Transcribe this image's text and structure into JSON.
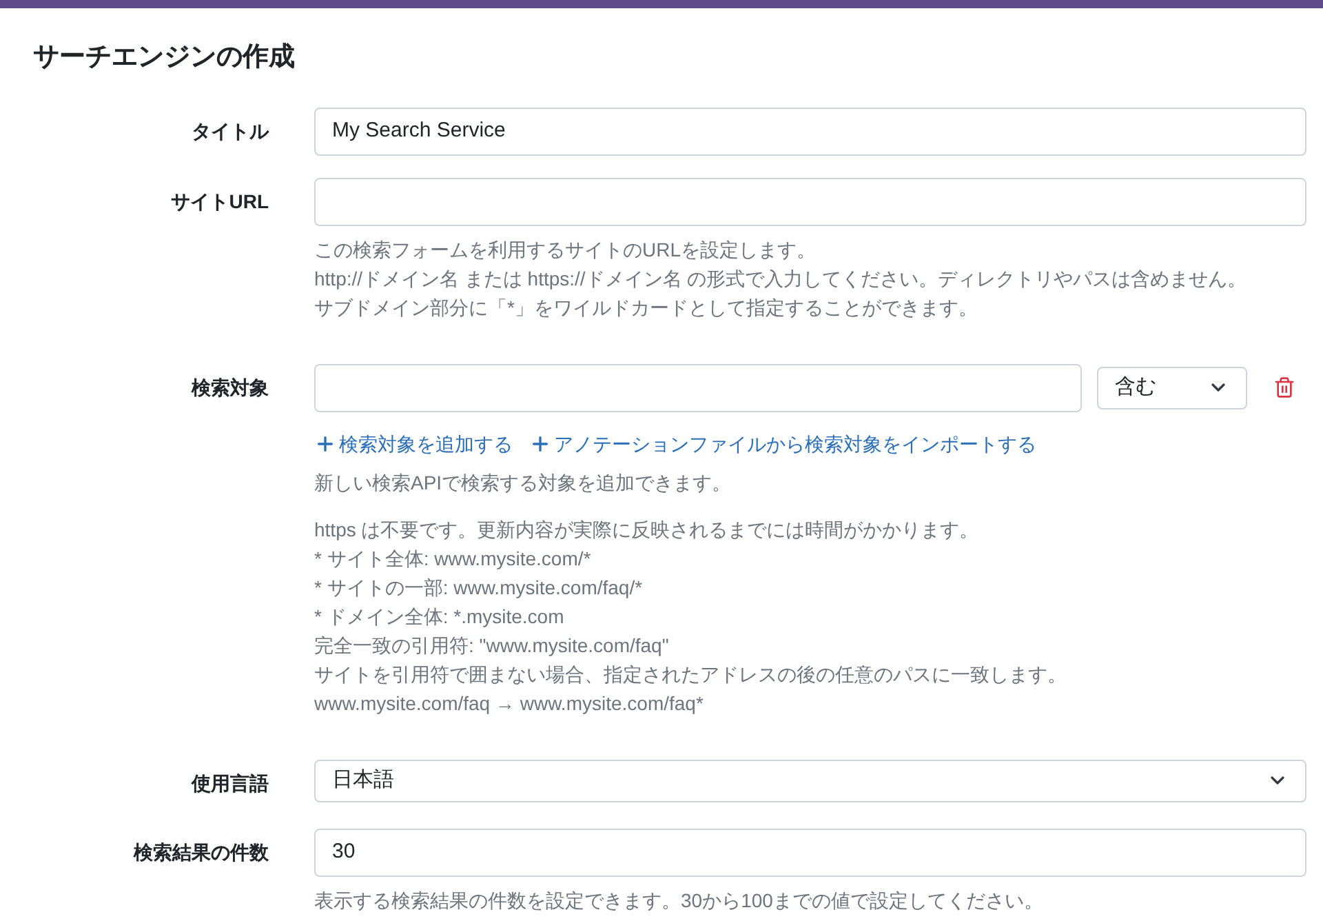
{
  "heading": "サーチエンジンの作成",
  "fields": [
    {
      "kind": "text",
      "label": "タイトル",
      "value": "My Search Service"
    },
    {
      "kind": "text",
      "label": "サイトURL",
      "help": [
        "この検索フォームを利用するサイトのURLを設定します。",
        "http://ドメイン名 または https://ドメイン名 の形式で入力してください。ディレクトリやパスは含めません。",
        "サブドメイン部分に「*」をワイルドカードとして指定することができます。"
      ]
    },
    {
      "kind": "target",
      "label": "検索対象",
      "match": "含む",
      "links": [
        "検索対象を追加する",
        "アノテーションファイルから検索対象をインポートする"
      ],
      "help": [
        "新しい検索APIで検索する対象を追加できます。"
      ],
      "notes": [
        "https は不要です。更新内容が実際に反映されるまでには時間がかかります。",
        "* サイト全体: www.mysite.com/*",
        "* サイトの一部: www.mysite.com/faq/*",
        "* ドメイン全体: *.mysite.com",
        "完全一致の引用符: \"www.mysite.com/faq\"",
        "サイトを引用符で囲まない場合、指定されたアドレスの後の任意のパスに一致します。",
        "www.mysite.com/faq → www.mysite.com/faq*"
      ]
    },
    {
      "kind": "select",
      "label": "使用言語",
      "value": "日本語"
    },
    {
      "kind": "text",
      "label": "検索結果の件数",
      "value": "30",
      "help": [
        "表示する検索結果の件数を設定できます。30から100までの値で設定してください。"
      ]
    }
  ]
}
